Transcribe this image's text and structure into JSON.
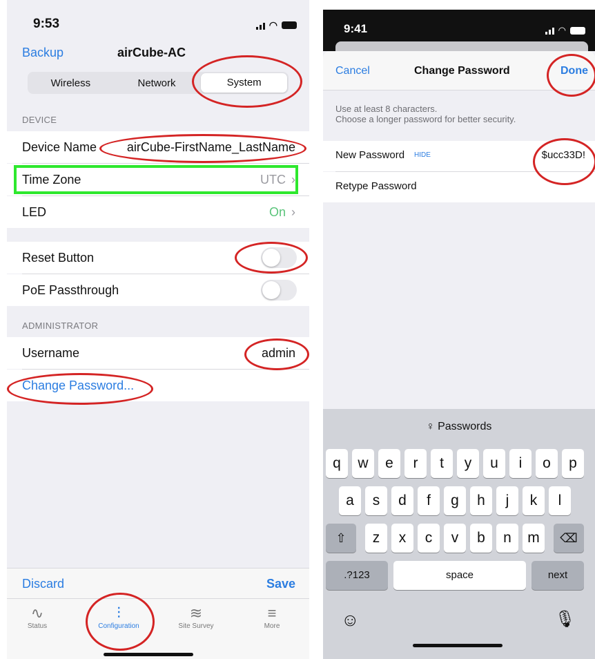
{
  "left": {
    "time": "9:53",
    "nav": {
      "back": "Backup",
      "title": "airCube-AC"
    },
    "segments": [
      "Wireless",
      "Network",
      "System"
    ],
    "device_section": "DEVICE",
    "device_name": {
      "label": "Device Name",
      "value": "airCube-FirstName_LastName"
    },
    "time_zone": {
      "label": "Time Zone",
      "value": "UTC"
    },
    "led": {
      "label": "LED",
      "value": "On"
    },
    "reset_button": {
      "label": "Reset Button",
      "on": false
    },
    "poe": {
      "label": "PoE Passthrough",
      "on": false
    },
    "admin_section": "ADMINISTRATOR",
    "username": {
      "label": "Username",
      "value": "admin"
    },
    "change_password": "Change Password...",
    "discard": "Discard",
    "save": "Save",
    "tabs": [
      {
        "label": "Status",
        "icon": "status-icon"
      },
      {
        "label": "Configuration",
        "icon": "sliders-icon"
      },
      {
        "label": "Site Survey",
        "icon": "wifi-icon"
      },
      {
        "label": "More",
        "icon": "menu-icon"
      }
    ],
    "colors": {
      "accent": "#2b7de1",
      "highlight_green": "#2ee82e",
      "annotation_red": "#d42424"
    }
  },
  "right": {
    "time": "9:41",
    "nav": {
      "cancel": "Cancel",
      "title": "Change Password",
      "done": "Done"
    },
    "hint_line1": "Use at least 8 characters.",
    "hint_line2": "Choose a longer password for better security.",
    "new_password": {
      "label": "New Password",
      "hide": "HIDE",
      "value": "$ucc33D!"
    },
    "retype_password": {
      "label": "Retype Password"
    },
    "keyboard": {
      "passwords": "Passwords",
      "row1": [
        "q",
        "w",
        "e",
        "r",
        "t",
        "y",
        "u",
        "i",
        "o",
        "p"
      ],
      "row2": [
        "a",
        "s",
        "d",
        "f",
        "g",
        "h",
        "j",
        "k",
        "l"
      ],
      "row3": [
        "z",
        "x",
        "c",
        "v",
        "b",
        "n",
        "m"
      ],
      "numbers": ".?123",
      "space": "space",
      "next": "next"
    }
  }
}
